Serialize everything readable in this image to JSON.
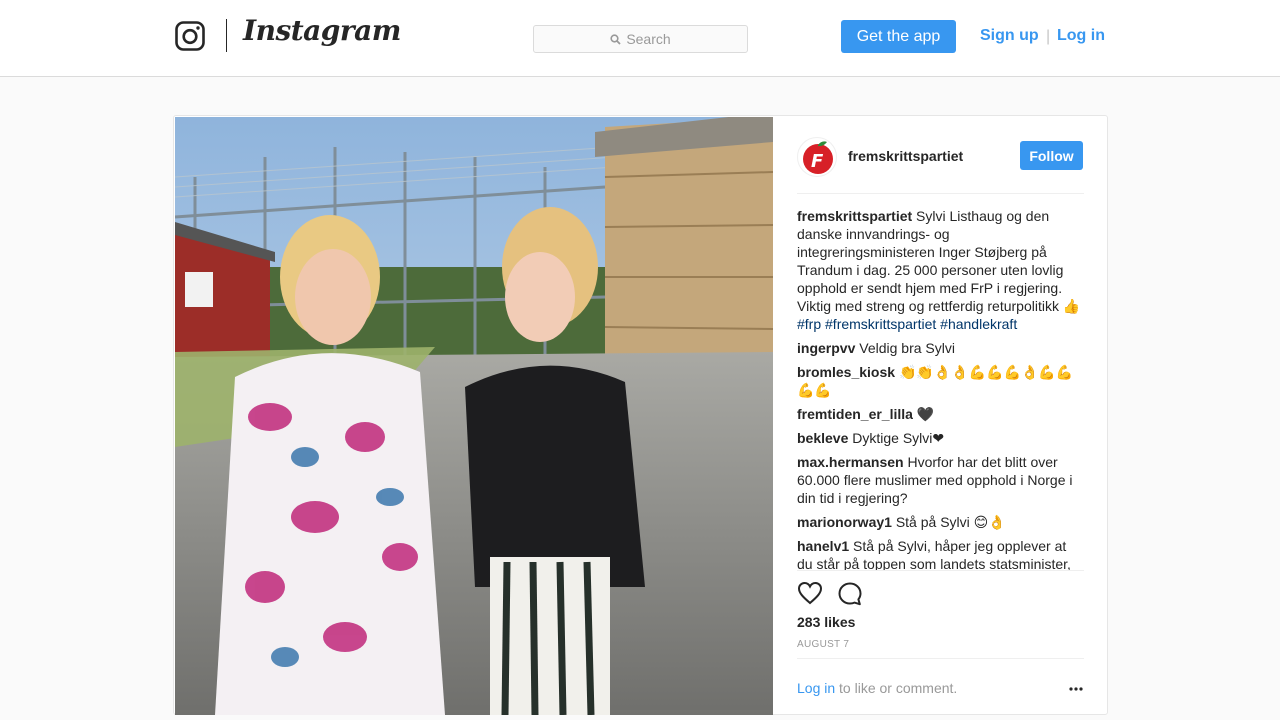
{
  "header": {
    "wordmark": "Instagram",
    "search_placeholder": "Search",
    "get_app_label": "Get the app",
    "sign_up_label": "Sign up",
    "separator": "|",
    "log_in_label": "Log in"
  },
  "post": {
    "username": "fremskrittspartiet",
    "follow_label": "Follow",
    "caption": {
      "username": "fremskrittspartiet",
      "text": "Sylvi Listhaug og den danske innvandrings- og integreringsministeren Inger Støjberg på Trandum i dag. 25 000 personer uten lovlig opphold er sendt hjem med FrP i regjering. Viktig med streng og rettferdig returpolitikk 👍",
      "hashtags": [
        "#frp",
        "#fremskrittspartiet",
        "#handlekraft"
      ]
    },
    "comments": [
      {
        "user": "ingerpvv",
        "text": "Veldig bra Sylvi"
      },
      {
        "user": "bromles_kiosk",
        "text": "👏👏👌👌💪💪💪👌💪💪💪💪"
      },
      {
        "user": "fremtiden_er_lilla",
        "text": "🖤"
      },
      {
        "user": "bekleve",
        "text": "Dyktige Sylvi❤"
      },
      {
        "user": "max.hermansen",
        "text": "Hvorfor har det blitt over 60.000 flere muslimer med opphold i Norge i din tid i regjering?"
      },
      {
        "user": "marionorway1",
        "text": "Stå på Sylvi 😊👌"
      },
      {
        "user": "hanelv1",
        "text": "Stå på Sylvi, håper jeg opplever at du står på toppen som landets statsminister, du er fornuftig, rettenkende og rettferdig. Du"
      }
    ],
    "likes": "283 likes",
    "date": "AUGUST 7",
    "login_prompt_link": "Log in",
    "login_prompt_text": " to like or comment."
  },
  "colors": {
    "accent": "#3897f0",
    "hashtag": "#003569",
    "muted": "#999999",
    "border": "#dbdbdb"
  },
  "icons": {
    "logo": "instagram-camera-icon",
    "search": "search-icon",
    "like": "heart-icon",
    "comment": "comment-bubble-icon",
    "more": "more-options-icon"
  }
}
